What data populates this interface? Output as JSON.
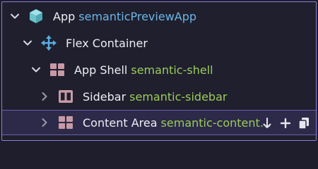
{
  "tree": {
    "rows": [
      {
        "name": "App",
        "semantic": "semanticPreviewApp",
        "icon": "cube-icon"
      },
      {
        "name": "Flex Container",
        "semantic": "",
        "icon": "move-arrows-icon"
      },
      {
        "name": "App Shell",
        "semantic": "semantic-shell",
        "icon": "grid-icon"
      },
      {
        "name": "Sidebar",
        "semantic": "semantic-sidebar",
        "icon": "columns-icon"
      },
      {
        "name": "Content Area",
        "semantic": "semantic-content-area",
        "icon": "grid-icon"
      }
    ]
  },
  "colors": {
    "background": "#1f1f2e",
    "border": "#8b7fd6",
    "selected_row": "#2c2a48",
    "semantic_blue": "#6cb6e6",
    "semantic_green": "#9ccc5a",
    "icon_teal": "#7fd0d8",
    "icon_blue": "#5aaee0",
    "icon_pink": "#c79aa6"
  }
}
